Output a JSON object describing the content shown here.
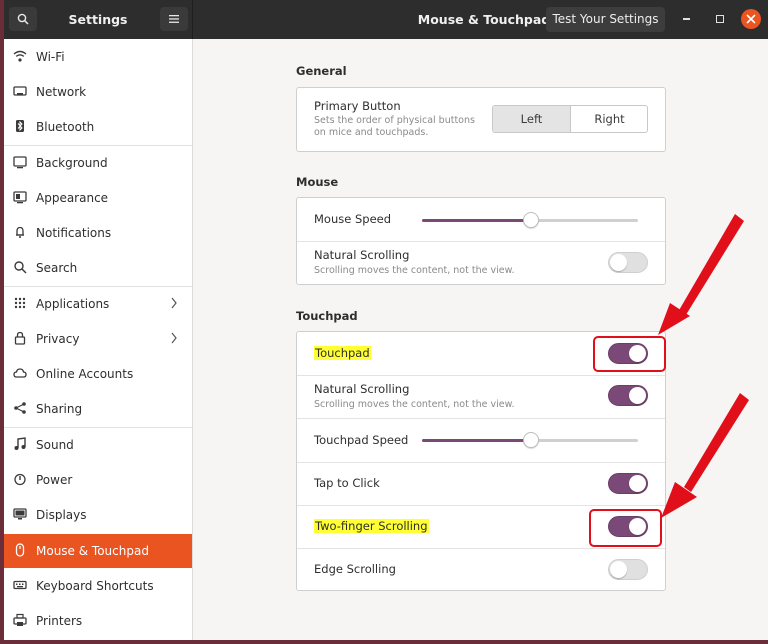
{
  "header": {
    "left_title": "Settings",
    "center_title": "Mouse & Touchpad",
    "test_button": "Test Your Settings"
  },
  "sidebar": {
    "items": [
      {
        "label": "Wi-Fi",
        "icon": "wifi-icon"
      },
      {
        "label": "Network",
        "icon": "network-icon"
      },
      {
        "label": "Bluetooth",
        "icon": "bluetooth-icon"
      },
      {
        "label": "Background",
        "icon": "background-icon"
      },
      {
        "label": "Appearance",
        "icon": "appearance-icon"
      },
      {
        "label": "Notifications",
        "icon": "bell-icon"
      },
      {
        "label": "Search",
        "icon": "search-icon"
      },
      {
        "label": "Applications",
        "icon": "grid-icon",
        "has_arrow": true
      },
      {
        "label": "Privacy",
        "icon": "lock-icon",
        "has_arrow": true
      },
      {
        "label": "Online Accounts",
        "icon": "cloud-icon"
      },
      {
        "label": "Sharing",
        "icon": "share-icon"
      },
      {
        "label": "Sound",
        "icon": "music-note-icon"
      },
      {
        "label": "Power",
        "icon": "power-icon"
      },
      {
        "label": "Displays",
        "icon": "display-icon"
      },
      {
        "label": "Mouse & Touchpad",
        "icon": "mouse-icon",
        "active": true
      },
      {
        "label": "Keyboard Shortcuts",
        "icon": "keyboard-icon"
      },
      {
        "label": "Printers",
        "icon": "printer-icon"
      }
    ]
  },
  "general": {
    "title": "General",
    "primary_button": {
      "title": "Primary Button",
      "subtitle_line1": "Sets the order of physical buttons",
      "subtitle_line2": "on mice and touchpads.",
      "options": [
        "Left",
        "Right"
      ],
      "selected": "Left"
    }
  },
  "mouse": {
    "title": "Mouse",
    "speed": {
      "label": "Mouse Speed",
      "value": 0.5
    },
    "natural_scrolling": {
      "label": "Natural Scrolling",
      "subtitle": "Scrolling moves the content, not the view.",
      "on": false
    }
  },
  "touchpad": {
    "title": "Touchpad",
    "touchpad": {
      "label": "Touchpad",
      "on": true
    },
    "natural_scrolling": {
      "label": "Natural Scrolling",
      "subtitle": "Scrolling moves the content, not the view.",
      "on": true
    },
    "speed": {
      "label": "Touchpad Speed",
      "value": 0.5
    },
    "tap_to_click": {
      "label": "Tap to Click",
      "on": true
    },
    "two_finger_scrolling": {
      "label": "Two-finger Scrolling",
      "on": true
    },
    "edge_scrolling": {
      "label": "Edge Scrolling",
      "on": false
    }
  },
  "colors": {
    "accent": "#e95420",
    "toggle_on": "#7b4978",
    "annotation": "#e00f1a",
    "highlight": "#ffff33"
  }
}
